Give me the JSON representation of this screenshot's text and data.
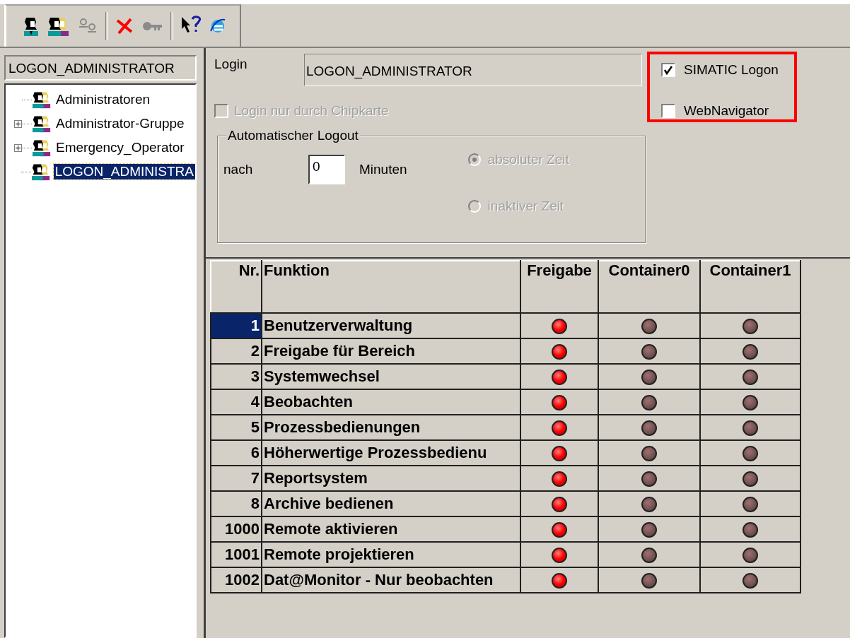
{
  "toolbar": [
    {
      "kind": "user",
      "disabled": false
    },
    {
      "kind": "group",
      "disabled": false
    },
    {
      "kind": "users-small",
      "disabled": true
    },
    {
      "kind": "separator"
    },
    {
      "kind": "delete",
      "disabled": false
    },
    {
      "kind": "key",
      "disabled": true
    },
    {
      "kind": "separator"
    },
    {
      "kind": "help",
      "disabled": false
    },
    {
      "kind": "globe",
      "disabled": false
    }
  ],
  "sidebar": {
    "title": "LOGON_ADMINISTRATOR",
    "tree": [
      {
        "label": "Administratoren",
        "expandable": false,
        "selected": false
      },
      {
        "label": "Administrator-Gruppe",
        "expandable": true,
        "selected": false
      },
      {
        "label": "Emergency_Operator",
        "expandable": true,
        "selected": false
      },
      {
        "label": "LOGON_ADMINISTRA",
        "expandable": false,
        "selected": true
      }
    ]
  },
  "form": {
    "login_label": "Login",
    "login_value": "LOGON_ADMINISTRATOR",
    "chipcard": {
      "label": "Login nur durch Chipkarte",
      "checked": false,
      "disabled": true
    },
    "logout_group": {
      "title": "Automatischer Logout",
      "prefix": "nach",
      "minutes": "0",
      "unit": "Minuten",
      "options": [
        {
          "label": "absoluter Zeit",
          "selected": true,
          "disabled": true
        },
        {
          "label": "inaktiver Zeit",
          "selected": false,
          "disabled": true
        }
      ]
    },
    "highlighted_options": [
      {
        "label": "SIMATIC Logon",
        "checked": true
      },
      {
        "label": "WebNavigator",
        "checked": false
      }
    ]
  },
  "table": {
    "columns": [
      "Nr.",
      "Funktion",
      "Freigabe",
      "Container0",
      "Container1"
    ],
    "rows": [
      {
        "nr": "1",
        "function": "Benutzerverwaltung",
        "selected": true,
        "lamps": [
          {
            "on": true
          },
          {
            "on": false
          },
          {
            "on": false
          }
        ]
      },
      {
        "nr": "2",
        "function": "Freigabe für Bereich",
        "selected": false,
        "lamps": [
          {
            "on": true
          },
          {
            "on": false
          },
          {
            "on": false
          }
        ]
      },
      {
        "nr": "3",
        "function": "Systemwechsel",
        "selected": false,
        "lamps": [
          {
            "on": true
          },
          {
            "on": false
          },
          {
            "on": false
          }
        ]
      },
      {
        "nr": "4",
        "function": "Beobachten",
        "selected": false,
        "lamps": [
          {
            "on": true
          },
          {
            "on": false
          },
          {
            "on": false
          }
        ]
      },
      {
        "nr": "5",
        "function": "Prozessbedienungen",
        "selected": false,
        "lamps": [
          {
            "on": true
          },
          {
            "on": false
          },
          {
            "on": false
          }
        ]
      },
      {
        "nr": "6",
        "function": "Höherwertige Prozessbedienu",
        "selected": false,
        "lamps": [
          {
            "on": true
          },
          {
            "on": false
          },
          {
            "on": false
          }
        ]
      },
      {
        "nr": "7",
        "function": "Reportsystem",
        "selected": false,
        "lamps": [
          {
            "on": true
          },
          {
            "on": false
          },
          {
            "on": false
          }
        ]
      },
      {
        "nr": "8",
        "function": "Archive bedienen",
        "selected": false,
        "lamps": [
          {
            "on": true
          },
          {
            "on": false
          },
          {
            "on": false
          }
        ]
      },
      {
        "nr": "1000",
        "function": "Remote aktivieren",
        "selected": false,
        "lamps": [
          {
            "on": true
          },
          {
            "on": false
          },
          {
            "on": false
          }
        ]
      },
      {
        "nr": "1001",
        "function": "Remote projektieren",
        "selected": false,
        "lamps": [
          {
            "on": true
          },
          {
            "on": false
          },
          {
            "on": false
          }
        ]
      },
      {
        "nr": "1002",
        "function": "Dat@Monitor - Nur beobachten",
        "selected": false,
        "lamps": [
          {
            "on": true
          },
          {
            "on": false
          },
          {
            "on": false
          }
        ]
      }
    ]
  }
}
